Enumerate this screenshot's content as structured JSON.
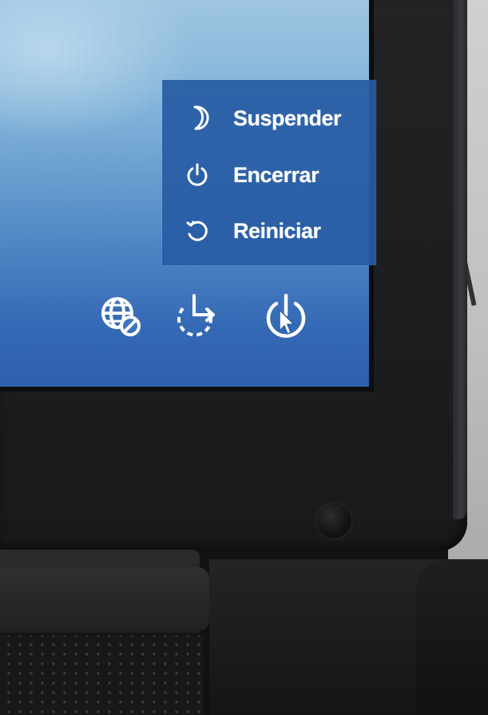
{
  "power_menu": {
    "items": [
      {
        "label": "Suspender",
        "icon": "moon-icon"
      },
      {
        "label": "Encerrar",
        "icon": "power-icon"
      },
      {
        "label": "Reiniciar",
        "icon": "restart-icon"
      }
    ]
  },
  "system_bar": {
    "buttons": [
      {
        "icon": "network-disconnected-icon"
      },
      {
        "icon": "ease-of-access-icon"
      },
      {
        "icon": "power-button-icon"
      }
    ]
  },
  "colors": {
    "menu_background": "#285CA5",
    "screen_background": "#4F8AC8",
    "text": "#FFFFFF",
    "bezel": "#1C1D1F"
  }
}
